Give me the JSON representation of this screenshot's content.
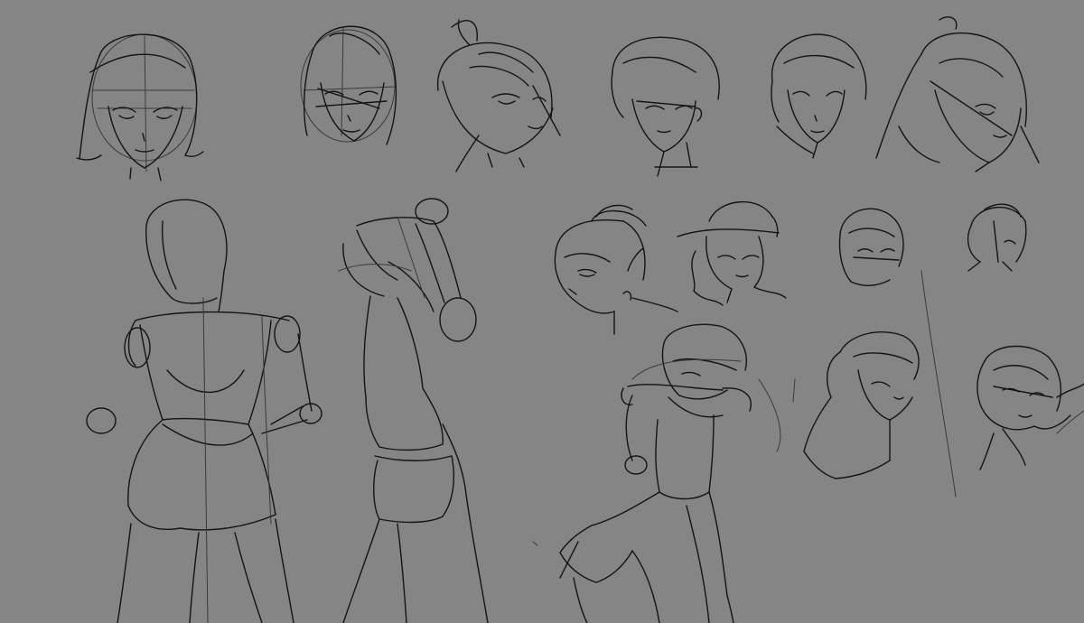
{
  "canvas": {
    "background_color": "#858585",
    "stroke_color": "#141414",
    "guide_stroke_color": "#3a3a3a"
  }
}
